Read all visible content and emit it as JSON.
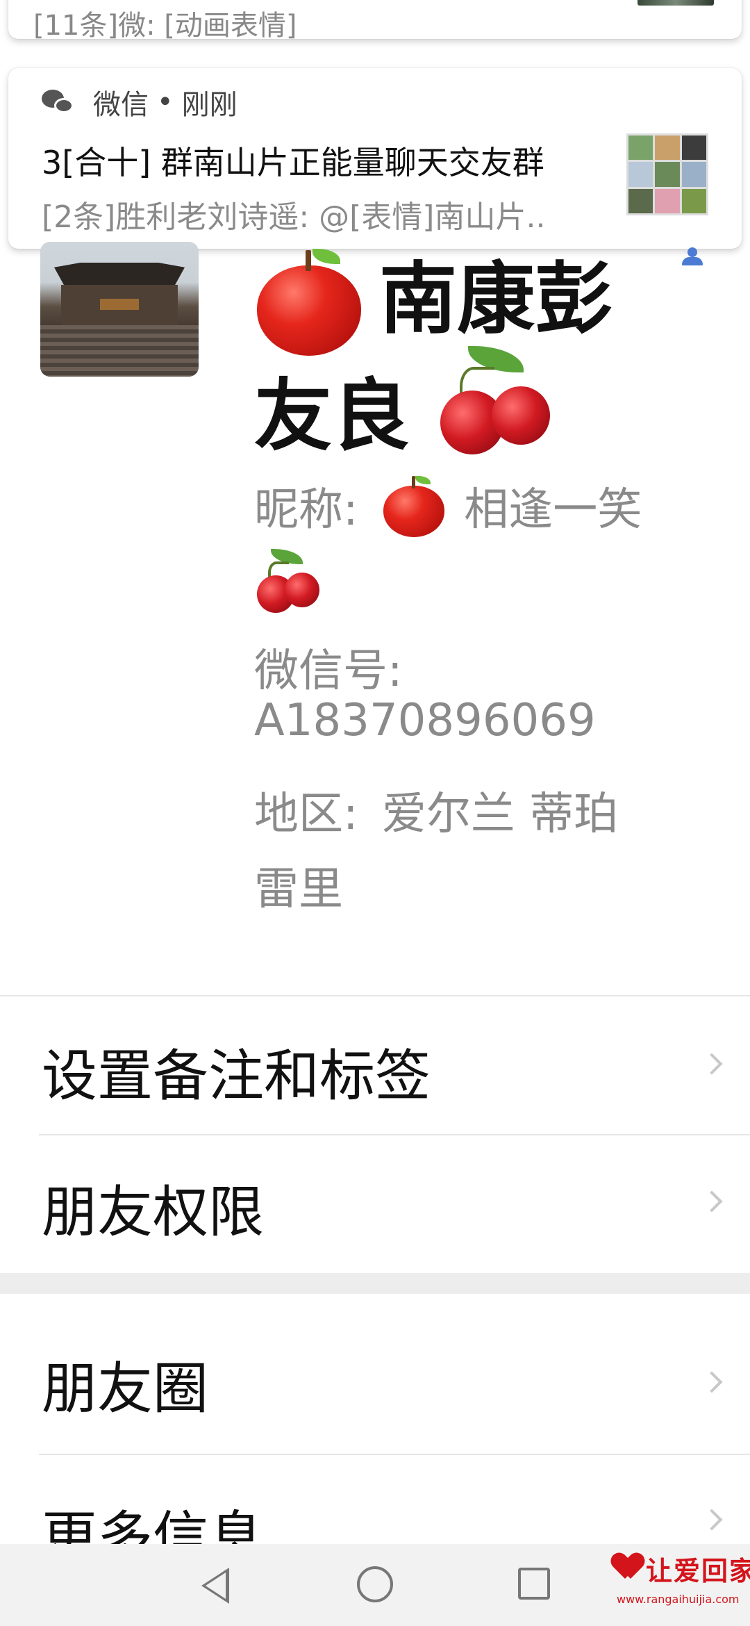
{
  "notifications": {
    "previous": {
      "text": "[11条]微: [动画表情]"
    },
    "current": {
      "app_name": "微信",
      "separator": "•",
      "time": "刚刚",
      "title": "3[合十] 群南山片正能量聊天交友群",
      "body": "[2条]胜利老刘诗遥: @[表情]南山片.."
    }
  },
  "profile": {
    "name_part1": "南康彭",
    "name_part2": "友良",
    "nickname_label": "昵称: ",
    "nickname": "相逢一笑",
    "wechat_id_label": "微信号:",
    "wechat_id": "A18370896069",
    "region_label": "地区: ",
    "region_line1": "爱尔兰  蒂珀",
    "region_line2": "雷里"
  },
  "menu": {
    "set_remark": "设置备注和标签",
    "friend_permissions": "朋友权限",
    "moments": "朋友圈",
    "more_info": "更多信息"
  },
  "watermark": {
    "brand": "让爱回家",
    "url": "www.rangaihuijia.com"
  },
  "colors": {
    "accent_blue": "#4b7bd3",
    "watermark_red": "#d4141b",
    "secondary_text": "#8a8a8a"
  },
  "icons": [
    "wechat-icon",
    "contact-icon",
    "apple-emoji",
    "cherry-emoji",
    "chevron-right-icon",
    "back-icon",
    "home-icon",
    "recents-icon",
    "heart-logo-icon"
  ]
}
